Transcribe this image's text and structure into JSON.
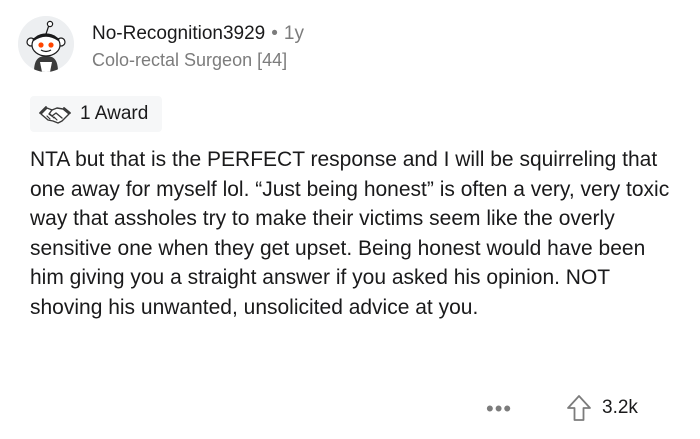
{
  "comment": {
    "author": "No-Recognition3929",
    "separator": "•",
    "age": "1y",
    "flair": "Colo-rectal Surgeon [44]",
    "award_label": "1 Award",
    "avatar_icon": "snoo-avatar-icon",
    "award_icon": "handshake-award-icon",
    "body": "NTA but that is the PERFECT response and I will be squirreling that one away for myself lol. “Just being honest” is often a very, very toxic way that assholes try to make their victims seem like the overly sensitive one when they get upset. Being honest would have been him giving you a straight answer if you asked his opinion. NOT shoving his unwanted, unsolicited advice at you."
  },
  "footer": {
    "more_label": "•••",
    "more_icon": "more-options-icon",
    "upvote_icon": "upvote-arrow-icon",
    "vote_count": "3.2k"
  },
  "colors": {
    "text": "#1a1a1b",
    "muted": "#7c7c7c",
    "chip_bg": "#f6f7f8",
    "avatar_accent": "#ff4500"
  }
}
